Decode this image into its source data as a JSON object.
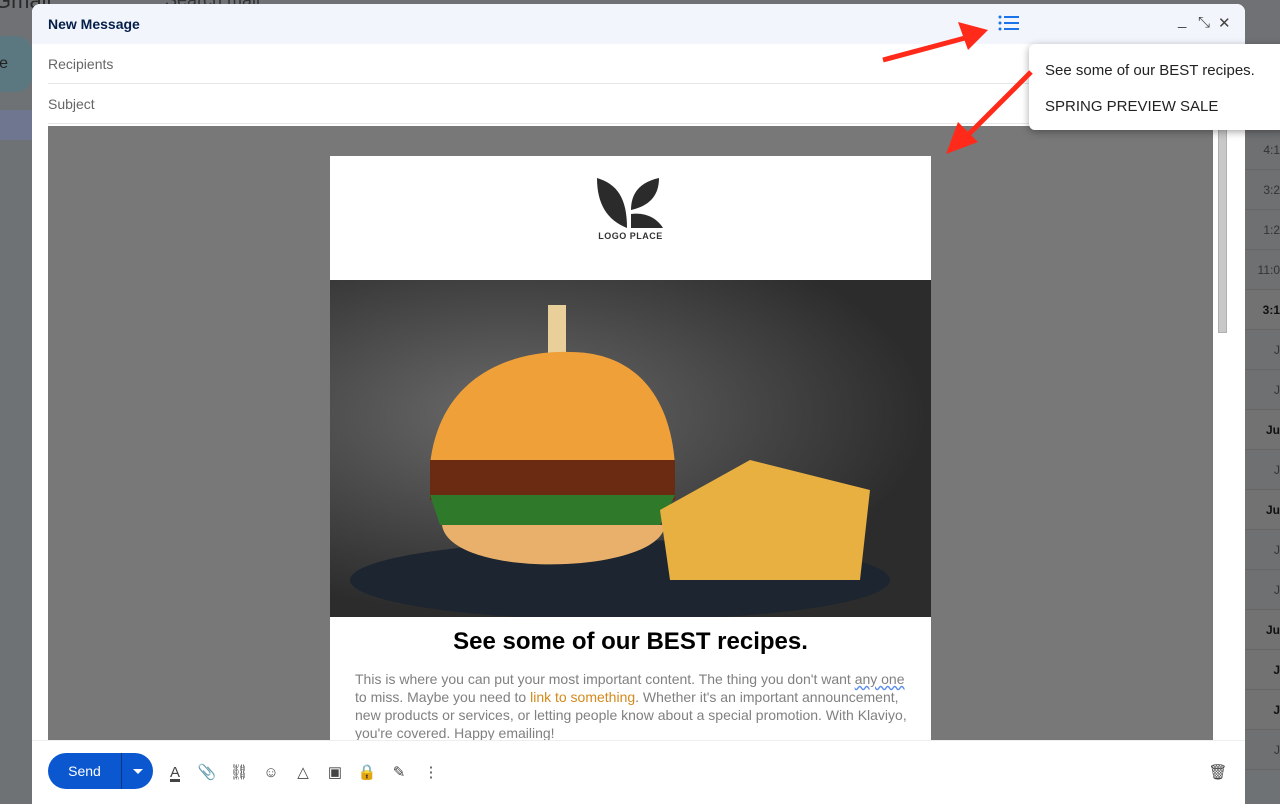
{
  "background": {
    "brand": "Gmail",
    "search_placeholder": "Search mail",
    "compose_label": "Compose",
    "times": [
      "4:1",
      "3:2",
      "1:2",
      "11:0",
      "3:1",
      "J",
      "J",
      "Ju",
      "J",
      "Ju",
      "J",
      "J",
      "Ju",
      "J",
      "J",
      "J"
    ],
    "bold": [
      false,
      false,
      false,
      false,
      true,
      false,
      false,
      true,
      false,
      true,
      false,
      false,
      true,
      true,
      true,
      false
    ]
  },
  "compose": {
    "title": "New Message",
    "recipients_placeholder": "Recipients",
    "subject_placeholder": "Subject",
    "send_label": "Send"
  },
  "email": {
    "logo_text": "LOGO PLACE",
    "heading": "See some of our BEST recipes.",
    "para_1": "This is where you can put your most important content. The thing you don't want ",
    "para_spell": "any one",
    "para_2": " to miss. Maybe you need to ",
    "link": "link to something",
    "para_3": ". Whether it's an important announcement, new products or services, or letting people know about a special promotion. With Klaviyo, you're covered. Happy emailing!"
  },
  "outline_popup": {
    "items": [
      "See some of our BEST recipes.",
      "SPRING PREVIEW SALE"
    ]
  },
  "colors": {
    "accent": "#0b57d0",
    "link": "#d4891c",
    "annotation": "#ff2a1a"
  }
}
